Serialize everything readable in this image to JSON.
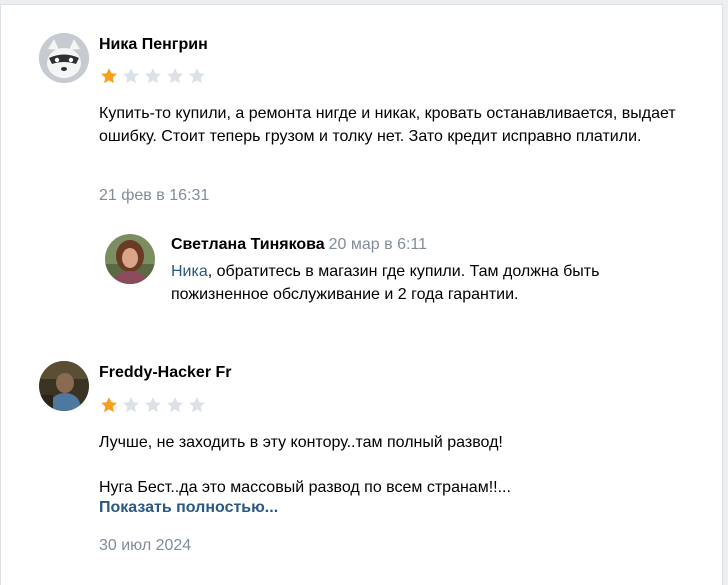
{
  "reviews": [
    {
      "author": "Ника Пенгрин",
      "rating": 1,
      "max_rating": 5,
      "text": "Купить-то купили, а ремонта нигде и никак, кровать останавливается, выдает ошибку. Стоит теперь грузом и толку нет. Зато кредит исправно платили.",
      "date": "21 фев в 16:31",
      "reply": {
        "author": "Светлана Тинякова",
        "date": "20 мар в 6:11",
        "mention": "Ника",
        "text": ", обратитесь в магазин где купили. Там должна быть пожизненное обслуживание и 2 года гарантии."
      }
    },
    {
      "author": "Freddy-Hacker Fr",
      "rating": 1,
      "max_rating": 5,
      "text_line1": "Лучше, не заходить в эту контору..там полный развод!",
      "text_line2": "Нуга Бест..да это массовый развод по всем странам!!...",
      "show_more": "Показать полностью...",
      "date": "30 июл 2024"
    }
  ],
  "colors": {
    "star_filled": "#f8a01c",
    "star_empty": "#dbe1e7",
    "link": "#2a5885",
    "muted": "#818c99"
  }
}
